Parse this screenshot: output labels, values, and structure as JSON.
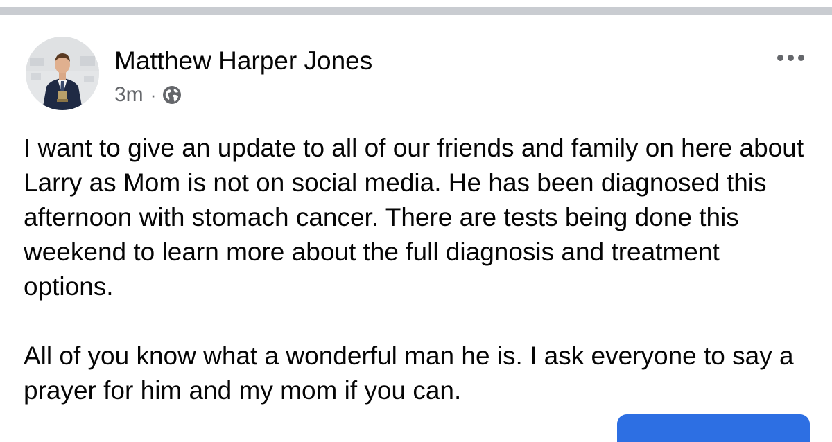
{
  "post": {
    "author": "Matthew Harper Jones",
    "timestamp": "3m",
    "separator": "·",
    "audience_icon": "globe-icon",
    "menu_icon": "more-horizontal-icon",
    "paragraphs": [
      "I want to give an update to all of our friends and family on here about Larry as Mom is not on social media. He has been diagnosed this afternoon with stomach cancer. There are tests being done this weekend to learn more about the full diagnosis and treatment options.",
      "All of you know what a wonderful man he is. I ask everyone to say a prayer for him and my mom if you can."
    ]
  },
  "colors": {
    "divider": "#c9ccd1",
    "text_primary": "#050505",
    "text_secondary": "#65676b",
    "accent_button": "#2d6fe3"
  }
}
